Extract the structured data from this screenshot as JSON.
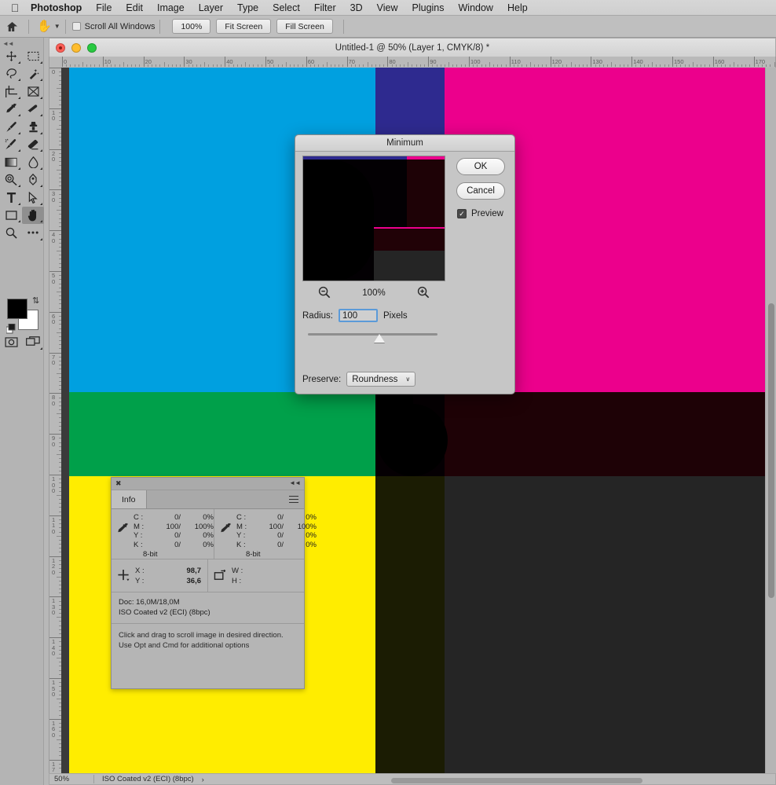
{
  "menubar": {
    "apple_icon": "apple-logo",
    "items": [
      {
        "label": "Photoshop",
        "bold": true
      },
      {
        "label": "File"
      },
      {
        "label": "Edit"
      },
      {
        "label": "Image"
      },
      {
        "label": "Layer"
      },
      {
        "label": "Type"
      },
      {
        "label": "Select"
      },
      {
        "label": "Filter"
      },
      {
        "label": "3D"
      },
      {
        "label": "View"
      },
      {
        "label": "Plugins"
      },
      {
        "label": "Window"
      },
      {
        "label": "Help"
      }
    ]
  },
  "options_bar": {
    "home_icon": "home-icon",
    "active_tool_icon": "hand-tool-icon",
    "scroll_all_windows": "Scroll All Windows",
    "scroll_all_windows_checked": false,
    "buttons": [
      {
        "label": "100%"
      },
      {
        "label": "Fit Screen"
      },
      {
        "label": "Fill Screen"
      }
    ]
  },
  "tools": {
    "collapse_icon": "collapse-panel-icon",
    "items": [
      {
        "name": "move-tool",
        "label": "Move Tool"
      },
      {
        "name": "rectangular-marquee-tool",
        "label": "Rectangular Marquee Tool"
      },
      {
        "name": "lasso-tool",
        "label": "Lasso Tool"
      },
      {
        "name": "quick-selection-tool",
        "label": "Quick Selection Tool"
      },
      {
        "name": "crop-tool",
        "label": "Crop Tool"
      },
      {
        "name": "frame-tool",
        "label": "Frame Tool"
      },
      {
        "name": "eyedropper-tool",
        "label": "Eyedropper Tool"
      },
      {
        "name": "healing-brush-tool",
        "label": "Spot Healing Brush Tool"
      },
      {
        "name": "brush-tool",
        "label": "Brush Tool"
      },
      {
        "name": "clone-stamp-tool",
        "label": "Clone Stamp Tool"
      },
      {
        "name": "history-brush-tool",
        "label": "History Brush Tool"
      },
      {
        "name": "eraser-tool",
        "label": "Eraser Tool"
      },
      {
        "name": "gradient-tool",
        "label": "Gradient Tool"
      },
      {
        "name": "blur-tool",
        "label": "Blur Tool"
      },
      {
        "name": "dodge-tool",
        "label": "Dodge Tool"
      },
      {
        "name": "pen-tool",
        "label": "Pen Tool"
      },
      {
        "name": "type-tool",
        "label": "Horizontal Type Tool"
      },
      {
        "name": "path-selection-tool",
        "label": "Path Selection Tool"
      },
      {
        "name": "rectangle-tool",
        "label": "Rectangle Tool"
      },
      {
        "name": "hand-tool",
        "label": "Hand Tool"
      },
      {
        "name": "zoom-tool",
        "label": "Zoom Tool"
      },
      {
        "name": "edit-toolbar-tool",
        "label": "Edit Toolbar"
      }
    ],
    "foreground_color": "#000000",
    "background_color": "#ffffff",
    "swap_icon": "swap-colors-icon",
    "default_icon": "default-colors-icon",
    "quickmask_icon": "quick-mask-icon",
    "screenmode_icon": "screen-mode-icon"
  },
  "document": {
    "title": "Untitled-1 @ 50% (Layer 1, CMYK/8) *",
    "traffic_lights": [
      "close",
      "minimize",
      "zoom"
    ],
    "zoom": "50%",
    "h_ruler_labels": [
      "0",
      "10",
      "20",
      "30",
      "40",
      "50",
      "60",
      "70",
      "80",
      "90",
      "100",
      "110",
      "120",
      "130",
      "140",
      "150",
      "160",
      "170"
    ],
    "v_ruler_labels": [
      "0",
      "10",
      "20",
      "30",
      "40",
      "50",
      "60",
      "70",
      "80",
      "90",
      "100",
      "110",
      "120",
      "130",
      "140",
      "150",
      "160",
      "170"
    ],
    "status_zoom": "50%",
    "status_profile": "ISO Coated v2 (ECI) (8bpc)",
    "status_caret": "›"
  },
  "canvas": {
    "colors": {
      "cyan": "#00a0e0",
      "blue": "#2e2a8f",
      "magenta": "#ec008c",
      "green": "#00a04a",
      "yellow": "#ffed00",
      "dark_red": "#1e0206",
      "near_black": "#050003",
      "dark_gray": "#252525",
      "dark_olive": "#1b1c03",
      "black": "#000000"
    }
  },
  "dialog": {
    "title": "Minimum",
    "ok_label": "OK",
    "cancel_label": "Cancel",
    "preview_label": "Preview",
    "preview_checked": true,
    "preview_check_glyph": "✓",
    "zoom_out_icon": "zoom-out-icon",
    "zoom_in_icon": "zoom-in-icon",
    "zoom_level": "100%",
    "radius_label": "Radius:",
    "radius_value": "100",
    "radius_units": "Pixels",
    "preserve_label": "Preserve:",
    "preserve_value": "Roundness",
    "preserve_chevron": "∨"
  },
  "info_panel": {
    "close_icon": "close-panel-icon",
    "collapse_icon": "collapse-panel-icon",
    "tab_label": "Info",
    "menu_icon": "panel-menu-icon",
    "readout_icon": "eyedropper-icon",
    "readouts": [
      {
        "channels": [
          {
            "label": "C :",
            "v1": "0/",
            "v2": "0%"
          },
          {
            "label": "M :",
            "v1": "100/",
            "v2": "100%"
          },
          {
            "label": "Y :",
            "v1": "0/",
            "v2": "0%"
          },
          {
            "label": "K :",
            "v1": "0/",
            "v2": "0%"
          }
        ],
        "depth": "8-bit"
      },
      {
        "channels": [
          {
            "label": "C :",
            "v1": "0/",
            "v2": "0%"
          },
          {
            "label": "M :",
            "v1": "100/",
            "v2": "100%"
          },
          {
            "label": "Y :",
            "v1": "0/",
            "v2": "0%"
          },
          {
            "label": "K :",
            "v1": "0/",
            "v2": "0%"
          }
        ],
        "depth": "8-bit"
      }
    ],
    "position_icon": "crosshair-icon",
    "position": [
      {
        "label": "X :",
        "value": "98,7"
      },
      {
        "label": "Y :",
        "value": "36,6"
      }
    ],
    "size_icon": "selection-size-icon",
    "size": [
      {
        "label": "W :",
        "value": ""
      },
      {
        "label": "H :",
        "value": ""
      }
    ],
    "doc_line": "Doc: 16,0M/18,0M",
    "profile_line": "ISO Coated v2 (ECI) (8bpc)",
    "hint_line1": "Click and drag to scroll image in desired direction.",
    "hint_line2": "Use Opt and Cmd for additional options"
  }
}
